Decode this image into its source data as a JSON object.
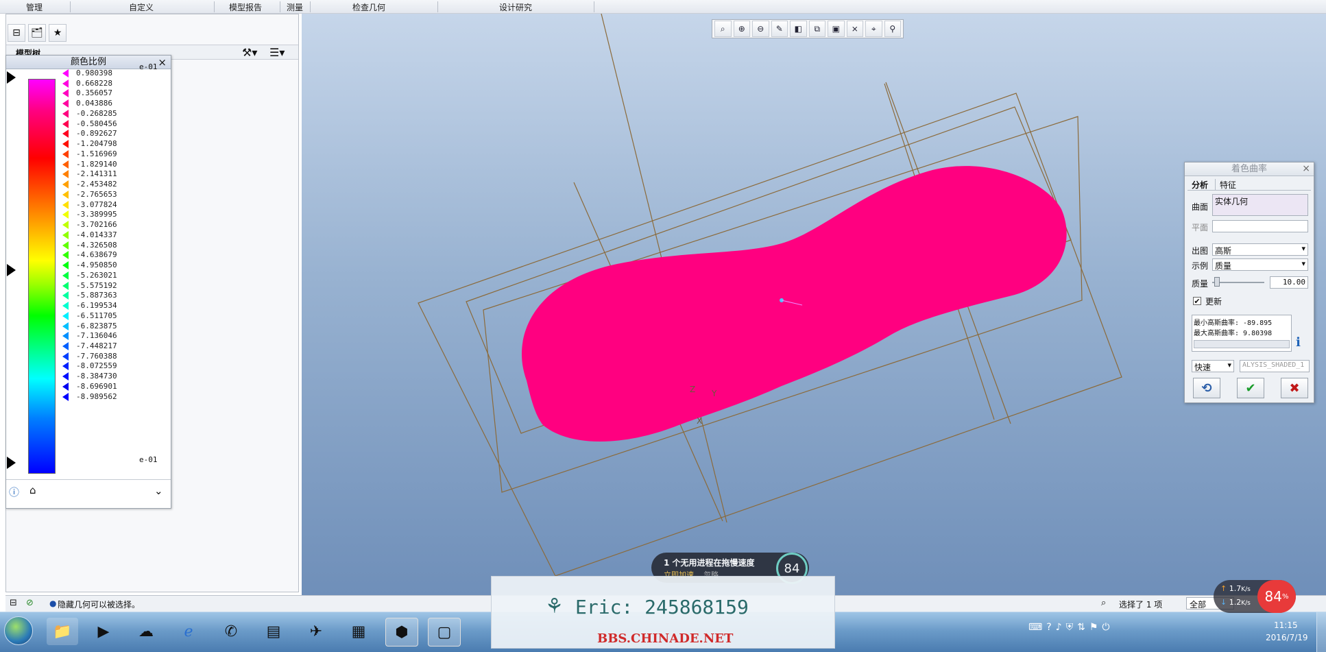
{
  "top_menu": [
    "管理",
    "自定义",
    "模型报告",
    "测量",
    "检查几何",
    "设计研究"
  ],
  "left_panel": {
    "model_tree_label": "模型树"
  },
  "color_scale": {
    "title": "颜色比例",
    "close": "×",
    "exponent_top": "e-01",
    "exponent_bottom": "e-01",
    "values": [
      {
        "v": "0.980398",
        "c": "#ff00ff"
      },
      {
        "v": "0.668228",
        "c": "#ff00e0"
      },
      {
        "v": "0.356057",
        "c": "#ff00c0"
      },
      {
        "v": "0.043886",
        "c": "#ff00a0"
      },
      {
        "v": "-0.268285",
        "c": "#ff0080"
      },
      {
        "v": "-0.580456",
        "c": "#ff0050"
      },
      {
        "v": "-0.892627",
        "c": "#ff0020"
      },
      {
        "v": "-1.204798",
        "c": "#ff1000"
      },
      {
        "v": "-1.516969",
        "c": "#ff4000"
      },
      {
        "v": "-1.829140",
        "c": "#ff6000"
      },
      {
        "v": "-2.141311",
        "c": "#ff8000"
      },
      {
        "v": "-2.453482",
        "c": "#ffa000"
      },
      {
        "v": "-2.765653",
        "c": "#ffc000"
      },
      {
        "v": "-3.077824",
        "c": "#ffe000"
      },
      {
        "v": "-3.389995",
        "c": "#f0ff00"
      },
      {
        "v": "-3.702166",
        "c": "#c0ff00"
      },
      {
        "v": "-4.014337",
        "c": "#90ff00"
      },
      {
        "v": "-4.326508",
        "c": "#60ff00"
      },
      {
        "v": "-4.638679",
        "c": "#30ff00"
      },
      {
        "v": "-4.950850",
        "c": "#00ff10"
      },
      {
        "v": "-5.263021",
        "c": "#00ff40"
      },
      {
        "v": "-5.575192",
        "c": "#00ff70"
      },
      {
        "v": "-5.887363",
        "c": "#00ffa0"
      },
      {
        "v": "-6.199534",
        "c": "#00ffd0"
      },
      {
        "v": "-6.511705",
        "c": "#00f0ff"
      },
      {
        "v": "-6.823875",
        "c": "#00c0ff"
      },
      {
        "v": "-7.136046",
        "c": "#0090ff"
      },
      {
        "v": "-7.448217",
        "c": "#0060ff"
      },
      {
        "v": "-7.760388",
        "c": "#0040ff"
      },
      {
        "v": "-8.072559",
        "c": "#0020ff"
      },
      {
        "v": "-8.384730",
        "c": "#0010ff"
      },
      {
        "v": "-8.696901",
        "c": "#0000f0"
      },
      {
        "v": "-8.989562",
        "c": "#0000ff"
      }
    ]
  },
  "view_toolbar": [
    "refit-icon",
    "zoom-in-icon",
    "zoom-out-icon",
    "repaint-icon",
    "display-style-icon",
    "saved-views-icon",
    "view-manager-icon",
    "datum-display-icon",
    "spin-center-icon",
    "annotation-icon"
  ],
  "model": {
    "shape_color": "#ff0080",
    "wire_color": "#8b6a3a",
    "csys_labels": [
      "Z",
      "Y",
      "X"
    ]
  },
  "curvature_dialog": {
    "title": "着色曲率",
    "close": "×",
    "tabs": [
      "分析",
      "特征"
    ],
    "surface_label": "曲面",
    "surface_value": "实体几何",
    "plane_label": "平面",
    "plot_label": "出图",
    "plot_value": "高斯",
    "sample_label": "示例",
    "sample_value": "质量",
    "quality_label": "质量",
    "quality_value": "10.00",
    "quality_level": 0.04,
    "update_label": "更新",
    "update_checked": true,
    "result_line1": "最小高斯曲率: -89.895",
    "result_line2": "最大高斯曲率: 9.80398",
    "mode_value": "快速",
    "name_value": "ALYSIS_SHADED_1"
  },
  "status": {
    "message": "隐藏几何可以被选择。",
    "selected": "选择了 1 项",
    "filter": "全部"
  },
  "popup": {
    "text": "1 个无用进程在拖慢速度",
    "action": "立即加速",
    "ignore": "忽略",
    "percent": "84"
  },
  "watermark": {
    "line1": "Eric: 245868159",
    "line2": "BBS.CHINADE.NET"
  },
  "net_badge": {
    "up": "1.7",
    "down": "1.2",
    "unit": "K/s",
    "percent": "84"
  },
  "taskbar": {
    "time": "11:15",
    "date": "2016/7/19"
  }
}
